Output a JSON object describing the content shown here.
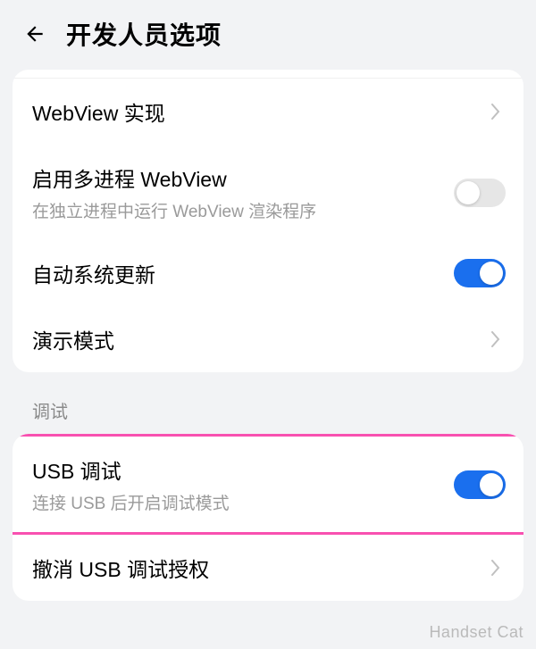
{
  "header": {
    "title": "开发人员选项"
  },
  "group1": {
    "webview": {
      "label": "WebView 实现"
    },
    "multiprocess": {
      "label": "启用多进程 WebView",
      "sublabel": "在独立进程中运行 WebView 渲染程序",
      "enabled": false
    },
    "autoupdate": {
      "label": "自动系统更新",
      "enabled": true
    },
    "demomode": {
      "label": "演示模式"
    }
  },
  "section_debug": {
    "label": "调试"
  },
  "group2": {
    "usbdebug": {
      "label": "USB 调试",
      "sublabel": "连接 USB 后开启调试模式",
      "enabled": true
    },
    "revoke": {
      "label": "撤消 USB 调试授权"
    }
  },
  "watermark": "Handset Cat"
}
